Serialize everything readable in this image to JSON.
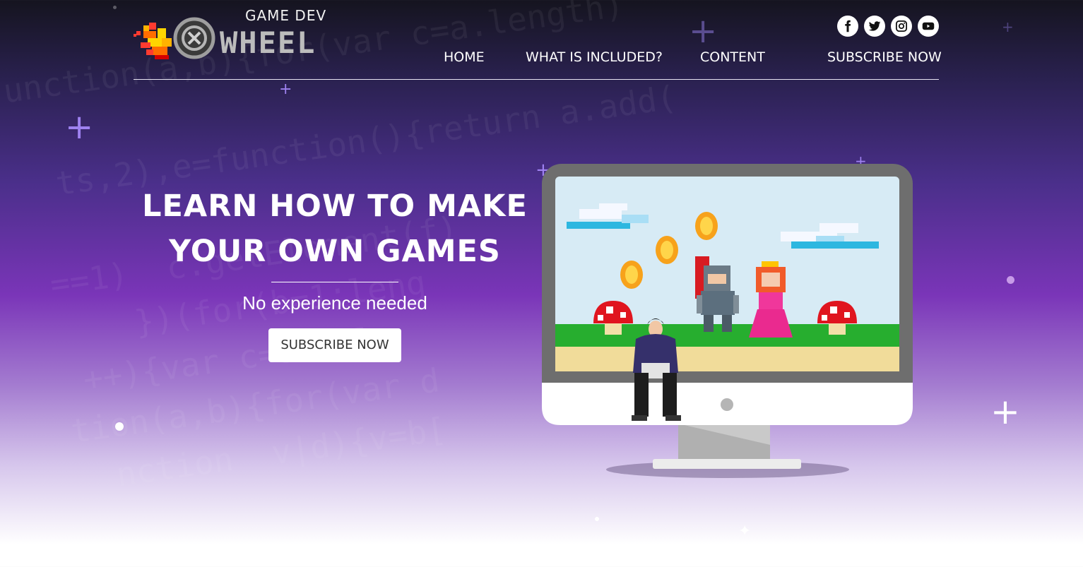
{
  "logo": {
    "top_text": "GAME DEV",
    "main_text": "WHEEL"
  },
  "socials": [
    "facebook-icon",
    "twitter-icon",
    "instagram-icon",
    "youtube-icon"
  ],
  "nav": {
    "items": [
      {
        "label": "HOME"
      },
      {
        "label": "WHAT IS INCLUDED?"
      },
      {
        "label": "CONTENT"
      },
      {
        "label": "SUBSCRIBE NOW"
      }
    ]
  },
  "hero": {
    "title_line1": "LEARN HOW TO MAKE",
    "title_line2": "YOUR OWN GAMES",
    "subtitle": "No experience needed",
    "cta_label": "SUBSCRIBE NOW"
  },
  "colors": {
    "accent_purple": "#7a35b8",
    "header_dark": "#15141f",
    "grass": "#27ae2f",
    "sand": "#f1dc9a",
    "sky": "#d7ebf5"
  }
}
